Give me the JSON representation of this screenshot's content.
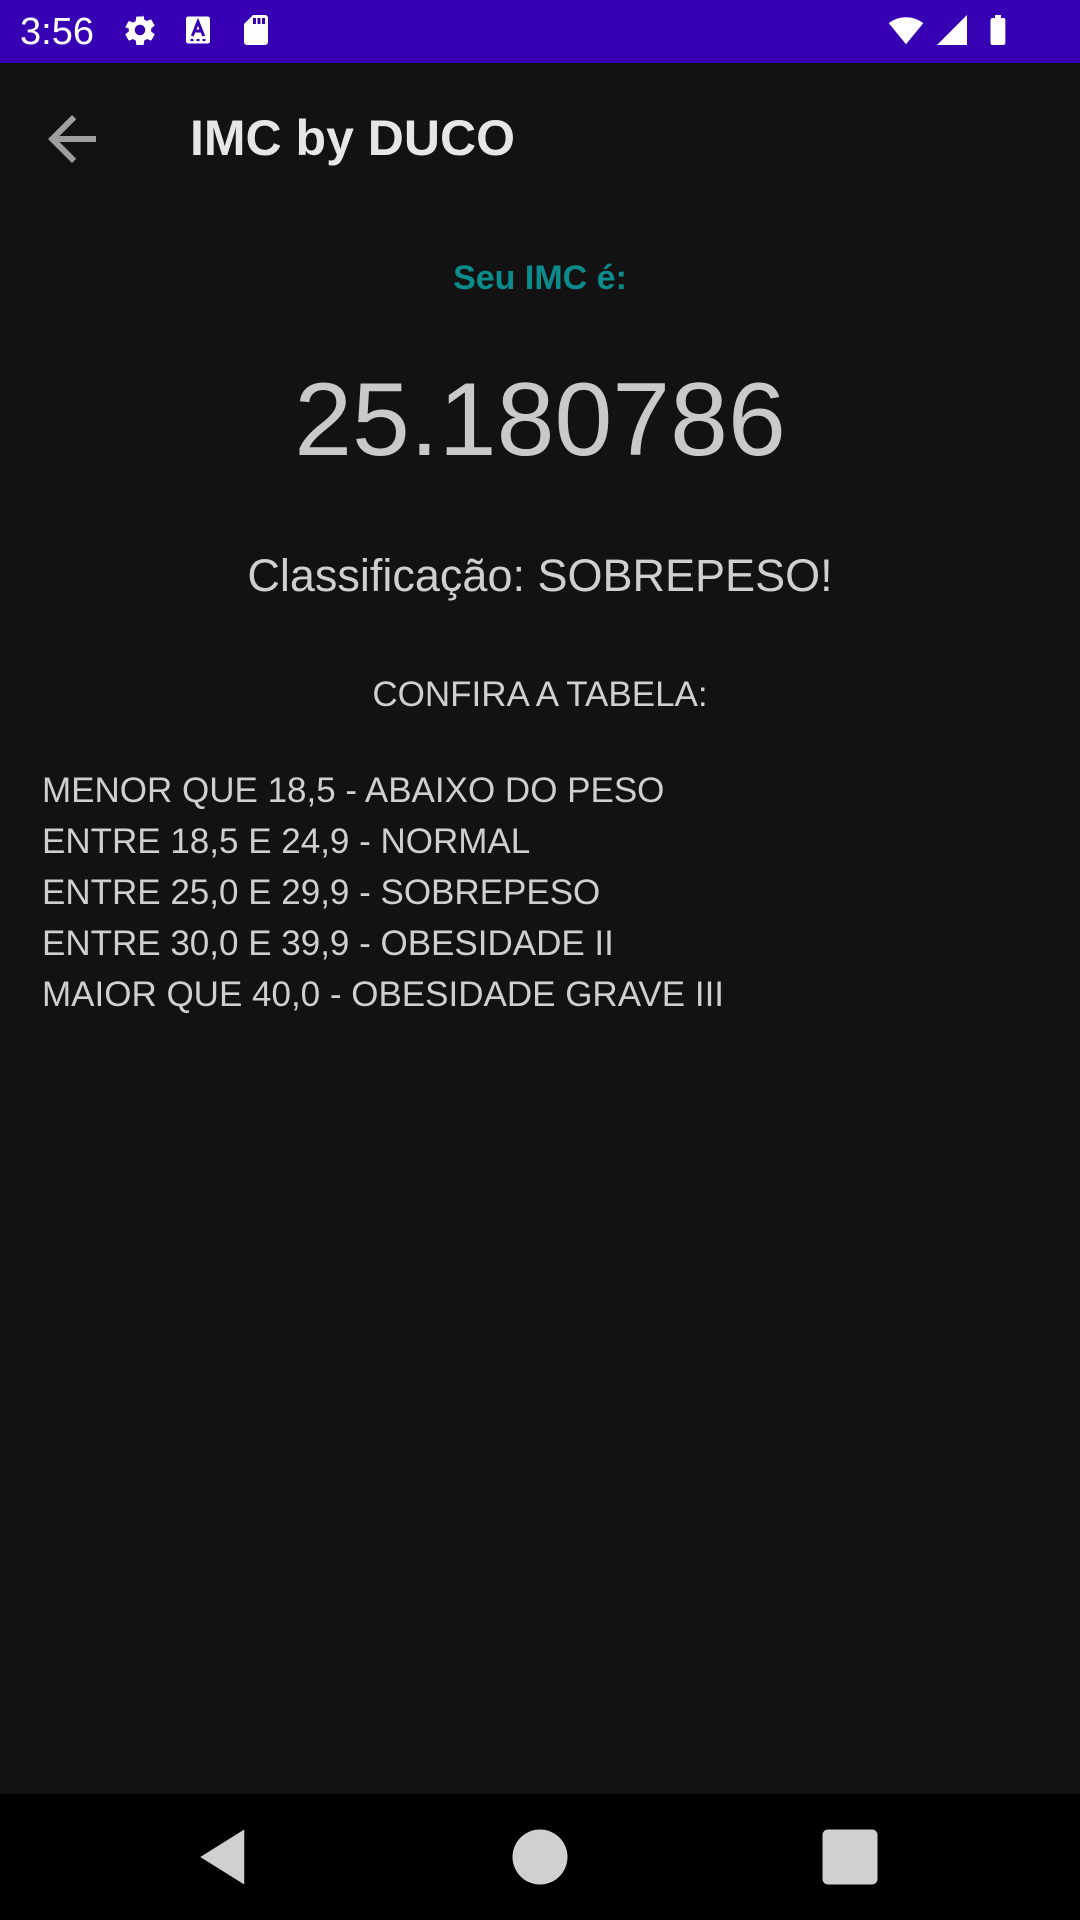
{
  "status_bar": {
    "time": "3:56",
    "background": "#3700b3",
    "icons_left": [
      "settings-icon",
      "font-icon",
      "sd-card-icon"
    ],
    "icons_right": [
      "wifi-icon",
      "signal-icon",
      "battery-icon"
    ]
  },
  "app_bar": {
    "title": "IMC by DUCO",
    "back_icon": "arrow-back-icon"
  },
  "result": {
    "label": "Seu IMC é:",
    "value": "25.180786",
    "classification": "Classificação: SOBREPESO!",
    "label_color": "#0b8c8c"
  },
  "table": {
    "heading": "CONFIRA A TABELA:",
    "rows": [
      "MENOR QUE 18,5 - ABAIXO DO PESO",
      "ENTRE 18,5 E 24,9 - NORMAL",
      "ENTRE 25,0 E 29,9 - SOBREPESO",
      "ENTRE 30,0 E 39,9 - OBESIDADE II",
      "MAIOR QUE 40,0 - OBESIDADE GRAVE III"
    ]
  },
  "nav_bar": {
    "buttons": [
      "back-triangle-icon",
      "home-circle-icon",
      "recents-square-icon"
    ]
  }
}
